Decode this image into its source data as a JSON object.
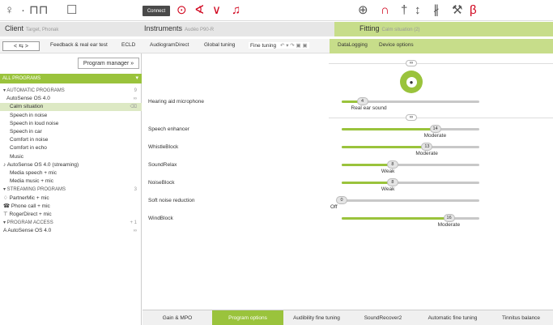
{
  "toolbar": {
    "connect_label": "Connect",
    "left_icons": [
      {
        "name": "user-icon",
        "glyph": "♀"
      },
      {
        "name": "dot-separator-icon",
        "glyph": "·"
      },
      {
        "name": "hearing-aid-pair-icon",
        "glyph": "⊓⊓"
      },
      {
        "name": "new-document-icon",
        "glyph": "☐"
      }
    ],
    "red_icons": [
      {
        "name": "sound-wave-icon",
        "glyph": "⊙"
      },
      {
        "name": "hearing-aid-red-icon",
        "glyph": "∢"
      },
      {
        "name": "hearing-aid-stereo-icon",
        "glyph": "∨"
      },
      {
        "name": "volume-icon",
        "glyph": "♫"
      }
    ],
    "right_icons": [
      {
        "name": "globe-icon",
        "glyph": "⊕"
      },
      {
        "name": "ear-icon",
        "glyph": "∩"
      },
      {
        "name": "tuning-fork-icon",
        "glyph": "†"
      },
      {
        "name": "equalizer-icon",
        "glyph": "↕"
      },
      {
        "name": "bars-icon",
        "glyph": "∦"
      },
      {
        "name": "wrench-icon",
        "glyph": "⚒"
      },
      {
        "name": "bluetooth-icon",
        "glyph": "β"
      }
    ]
  },
  "header": {
    "client_label": "Client",
    "client_name": "Target, Phonak",
    "instruments_label": "Instruments",
    "instruments_name": "Audéo P90-R",
    "fitting_label": "Fitting",
    "fitting_sub": "Calm situation (2)"
  },
  "subnav": {
    "back_forward": "< ⇆ >",
    "links": [
      {
        "label": "Feedback & real ear test"
      },
      {
        "label": "ECLD"
      },
      {
        "label": "AudiogramDirect"
      },
      {
        "label": "Global tuning"
      },
      {
        "label": "Fine tuning"
      },
      {
        "label": "DataLogging"
      },
      {
        "label": "Device options"
      }
    ],
    "fine_tuning_controls": "↶ ▾ ↷ ▣ ▣"
  },
  "left": {
    "program_manager_label": "Program manager »",
    "all_programs_label": "ALL PROGRAMS",
    "rows": [
      {
        "label": "▾ AUTOMATIC PROGRAMS",
        "right": "9",
        "indent": 4,
        "grp": true,
        "sel": false
      },
      {
        "label": "AutoSense OS 4.0",
        "right": "∞",
        "indent": 8,
        "grp": false,
        "sel": false
      },
      {
        "label": "Calm situation",
        "right": "⌫",
        "indent": 12,
        "grp": false,
        "sel": true
      },
      {
        "label": "Speech in noise",
        "right": "",
        "indent": 12,
        "grp": false,
        "sel": false
      },
      {
        "label": "Speech in loud noise",
        "right": "",
        "indent": 12,
        "grp": false,
        "sel": false
      },
      {
        "label": "Speech in car",
        "right": "",
        "indent": 12,
        "grp": false,
        "sel": false
      },
      {
        "label": "Comfort in noise",
        "right": "",
        "indent": 12,
        "grp": false,
        "sel": false
      },
      {
        "label": "Comfort in echo",
        "right": "",
        "indent": 12,
        "grp": false,
        "sel": false
      },
      {
        "label": "Music",
        "right": "",
        "indent": 12,
        "grp": false,
        "sel": false
      },
      {
        "label": "♪ AutoSense OS 4.0 (streaming)",
        "right": "",
        "indent": 4,
        "grp": false,
        "sel": false
      },
      {
        "label": "Media speech + mic",
        "right": "",
        "indent": 12,
        "grp": false,
        "sel": false
      },
      {
        "label": "Media music + mic",
        "right": "",
        "indent": 12,
        "grp": false,
        "sel": false
      },
      {
        "label": "▾ STREAMING PROGRAMS",
        "right": "3",
        "indent": 4,
        "grp": true,
        "sel": false
      },
      {
        "label": "♢ PartnerMic + mic",
        "right": "",
        "indent": 4,
        "grp": false,
        "sel": false
      },
      {
        "label": "☎ Phone call + mic",
        "right": "",
        "indent": 4,
        "grp": false,
        "sel": false
      },
      {
        "label": "⊤ RogerDirect + mic",
        "right": "",
        "indent": 4,
        "grp": false,
        "sel": false
      },
      {
        "label": "▾ PROGRAM ACCESS",
        "right": "+  1",
        "indent": 4,
        "grp": true,
        "sel": false
      },
      {
        "label": "A  AutoSense OS 4.0",
        "right": "∞",
        "indent": 4,
        "grp": false,
        "sel": false
      }
    ]
  },
  "main": {
    "rows": [
      {
        "label": "Hearing aid microphone",
        "value": "4",
        "pos": 0.15,
        "sub": "Real ear sound",
        "linked": false
      },
      {
        "label": "Speech enhancer",
        "value": "14",
        "pos": 0.68,
        "sub": "Moderate",
        "linked": true
      },
      {
        "label": "WhistleBlock",
        "value": "13",
        "pos": 0.62,
        "sub": "Moderate",
        "linked": false
      },
      {
        "label": "SoundRelax",
        "value": "8",
        "pos": 0.37,
        "sub": "Weak",
        "linked": false
      },
      {
        "label": "NoiseBlock",
        "value": "8",
        "pos": 0.37,
        "sub": "Weak",
        "linked": false
      },
      {
        "label": "Soft noise reduction",
        "value": "0",
        "pos": 0.0,
        "sub": "Off",
        "linked": false
      },
      {
        "label": "WindBlock",
        "value": "16",
        "pos": 0.78,
        "sub": "Moderate",
        "linked": false
      }
    ]
  },
  "bottom_tabs": [
    {
      "label": "Gain & MPO",
      "active": false
    },
    {
      "label": "Program options",
      "active": true
    },
    {
      "label": "Audibility fine tuning",
      "active": false
    },
    {
      "label": "SoundRecover2",
      "active": false
    },
    {
      "label": "Automatic fine tuning",
      "active": false
    },
    {
      "label": "Tinnitus balance",
      "active": false
    }
  ],
  "colors": {
    "accent_green": "#9ac33c",
    "light_green": "#c7dd8a",
    "red": "#d0021b"
  }
}
